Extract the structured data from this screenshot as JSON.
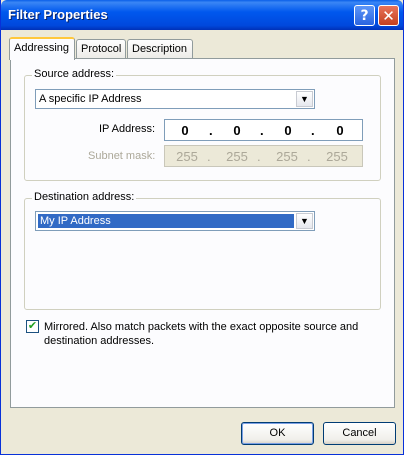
{
  "window": {
    "title": "Filter Properties",
    "help_glyph": "?",
    "close_glyph": "✕"
  },
  "tabs": [
    {
      "label": "Addressing",
      "active": true
    },
    {
      "label": "Protocol",
      "active": false
    },
    {
      "label": "Description",
      "active": false
    }
  ],
  "source": {
    "legend": "Source address:",
    "selected": "A specific IP Address",
    "ip_label": "IP Address:",
    "ip": [
      "0",
      "0",
      "0",
      "0"
    ],
    "mask_label": "Subnet mask:",
    "mask": [
      "255",
      "255",
      "255",
      "255"
    ]
  },
  "destination": {
    "legend": "Destination address:",
    "selected": "My IP Address"
  },
  "mirrored": {
    "checked": true,
    "label": "Mirrored. Also match packets with the exact opposite source and destination addresses."
  },
  "buttons": {
    "ok": "OK",
    "cancel": "Cancel"
  },
  "icons": {
    "help": "help-icon",
    "close": "close-icon",
    "dropdown": "chevron-down-icon",
    "check": "checkmark-icon"
  }
}
